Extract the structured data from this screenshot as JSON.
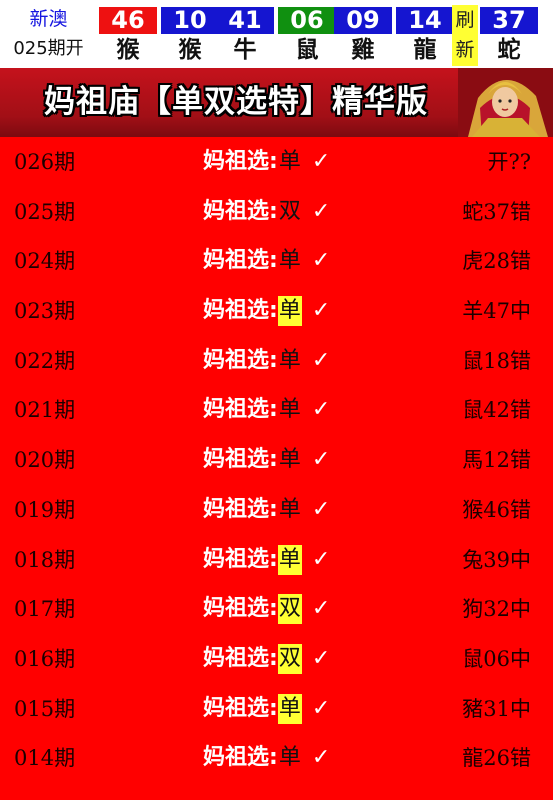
{
  "header": {
    "region": "新澳",
    "period": "025期开",
    "refresh_top": "刷",
    "refresh_bottom": "新",
    "balls": [
      {
        "num": "46",
        "zodiac": "猴",
        "color": "#ee1111"
      },
      {
        "num": "10",
        "zodiac": "猴",
        "color": "#1515d0"
      },
      {
        "num": "41",
        "zodiac": "牛",
        "color": "#1515d0"
      },
      {
        "num": "06",
        "zodiac": "鼠",
        "color": "#109010"
      },
      {
        "num": "09",
        "zodiac": "雞",
        "color": "#1515d0"
      },
      {
        "num": "14",
        "zodiac": "龍",
        "color": "#1515d0"
      },
      {
        "num": "37",
        "zodiac": "蛇",
        "color": "#1515d0"
      }
    ]
  },
  "banner": {
    "title": "妈祖庙【单双选特】精华版"
  },
  "pick_label": "妈祖选:",
  "check_mark": "✓",
  "rows": [
    {
      "issue": "026期",
      "pick": "单",
      "highlight": false,
      "result": "开??"
    },
    {
      "issue": "025期",
      "pick": "双",
      "highlight": false,
      "result": "蛇37错"
    },
    {
      "issue": "024期",
      "pick": "单",
      "highlight": false,
      "result": "虎28错"
    },
    {
      "issue": "023期",
      "pick": "单",
      "highlight": true,
      "result": "羊47中"
    },
    {
      "issue": "022期",
      "pick": "单",
      "highlight": false,
      "result": "鼠18错"
    },
    {
      "issue": "021期",
      "pick": "单",
      "highlight": false,
      "result": "鼠42错"
    },
    {
      "issue": "020期",
      "pick": "单",
      "highlight": false,
      "result": "馬12错"
    },
    {
      "issue": "019期",
      "pick": "单",
      "highlight": false,
      "result": "猴46错"
    },
    {
      "issue": "018期",
      "pick": "单",
      "highlight": true,
      "result": "兔39中"
    },
    {
      "issue": "017期",
      "pick": "双",
      "highlight": true,
      "result": "狗32中"
    },
    {
      "issue": "016期",
      "pick": "双",
      "highlight": true,
      "result": "鼠06中"
    },
    {
      "issue": "015期",
      "pick": "单",
      "highlight": true,
      "result": "豬31中"
    },
    {
      "issue": "014期",
      "pick": "单",
      "highlight": false,
      "result": "龍26错"
    }
  ]
}
